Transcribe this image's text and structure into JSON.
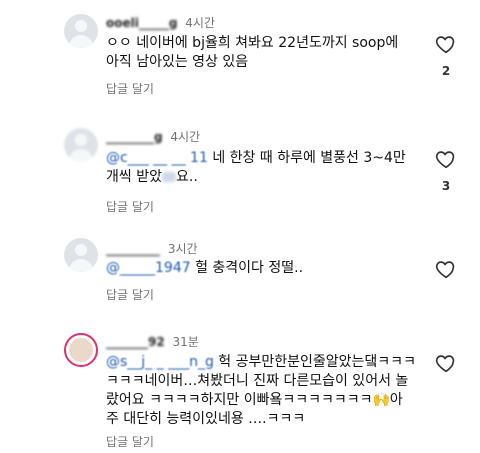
{
  "comments": [
    {
      "username": "ooeli_____g",
      "time": "4시간",
      "lines": [
        "ㅇㅇ 네이버에 bj율희 쳐봐요 22년도까지 soop에",
        "아직 남아있는 영상 있음"
      ],
      "reply_label": "답글 달기",
      "likes": "2",
      "like_icon": "heart-outline-icon"
    },
    {
      "username": "________g",
      "time": "4시간",
      "mention": "@c___ __ __ 11",
      "line1_rest": " 네 한창 때 하루에 별풍선 3~4만",
      "line2": "개씩 받았",
      "line2_tail": "요..",
      "reply_label": "답글 달기",
      "likes": "3",
      "like_icon": "heart-outline-icon"
    },
    {
      "username": "_________",
      "time": "3시간",
      "mention": "@_____1947",
      "line1_rest": " 헐 충격이다 정떨..",
      "reply_label": "답글 달기",
      "likes": "",
      "like_icon": "heart-outline-icon"
    },
    {
      "username": "_______92",
      "time": "31분",
      "mention": "@s__j_ _ ___n_g",
      "line1_rest": " 헉 공부만한분인줄알았는댘ㅋㅋㅋ",
      "lines_rest": [
        "ㅋㅋㅋ네이버…쳐봤더니 진짜 다른모습이 있어서 놀",
        "랐어요 ㅋㅋㅋㅋ하지만 이빠욬ㅋㅋㅋㅋㅋㅋㅋ🙌아",
        "주 대단히 능력이있네용 ….ㅋㅋㅋ"
      ],
      "reply_label": "답글 달기",
      "likes": "",
      "like_icon": "heart-outline-icon"
    }
  ]
}
